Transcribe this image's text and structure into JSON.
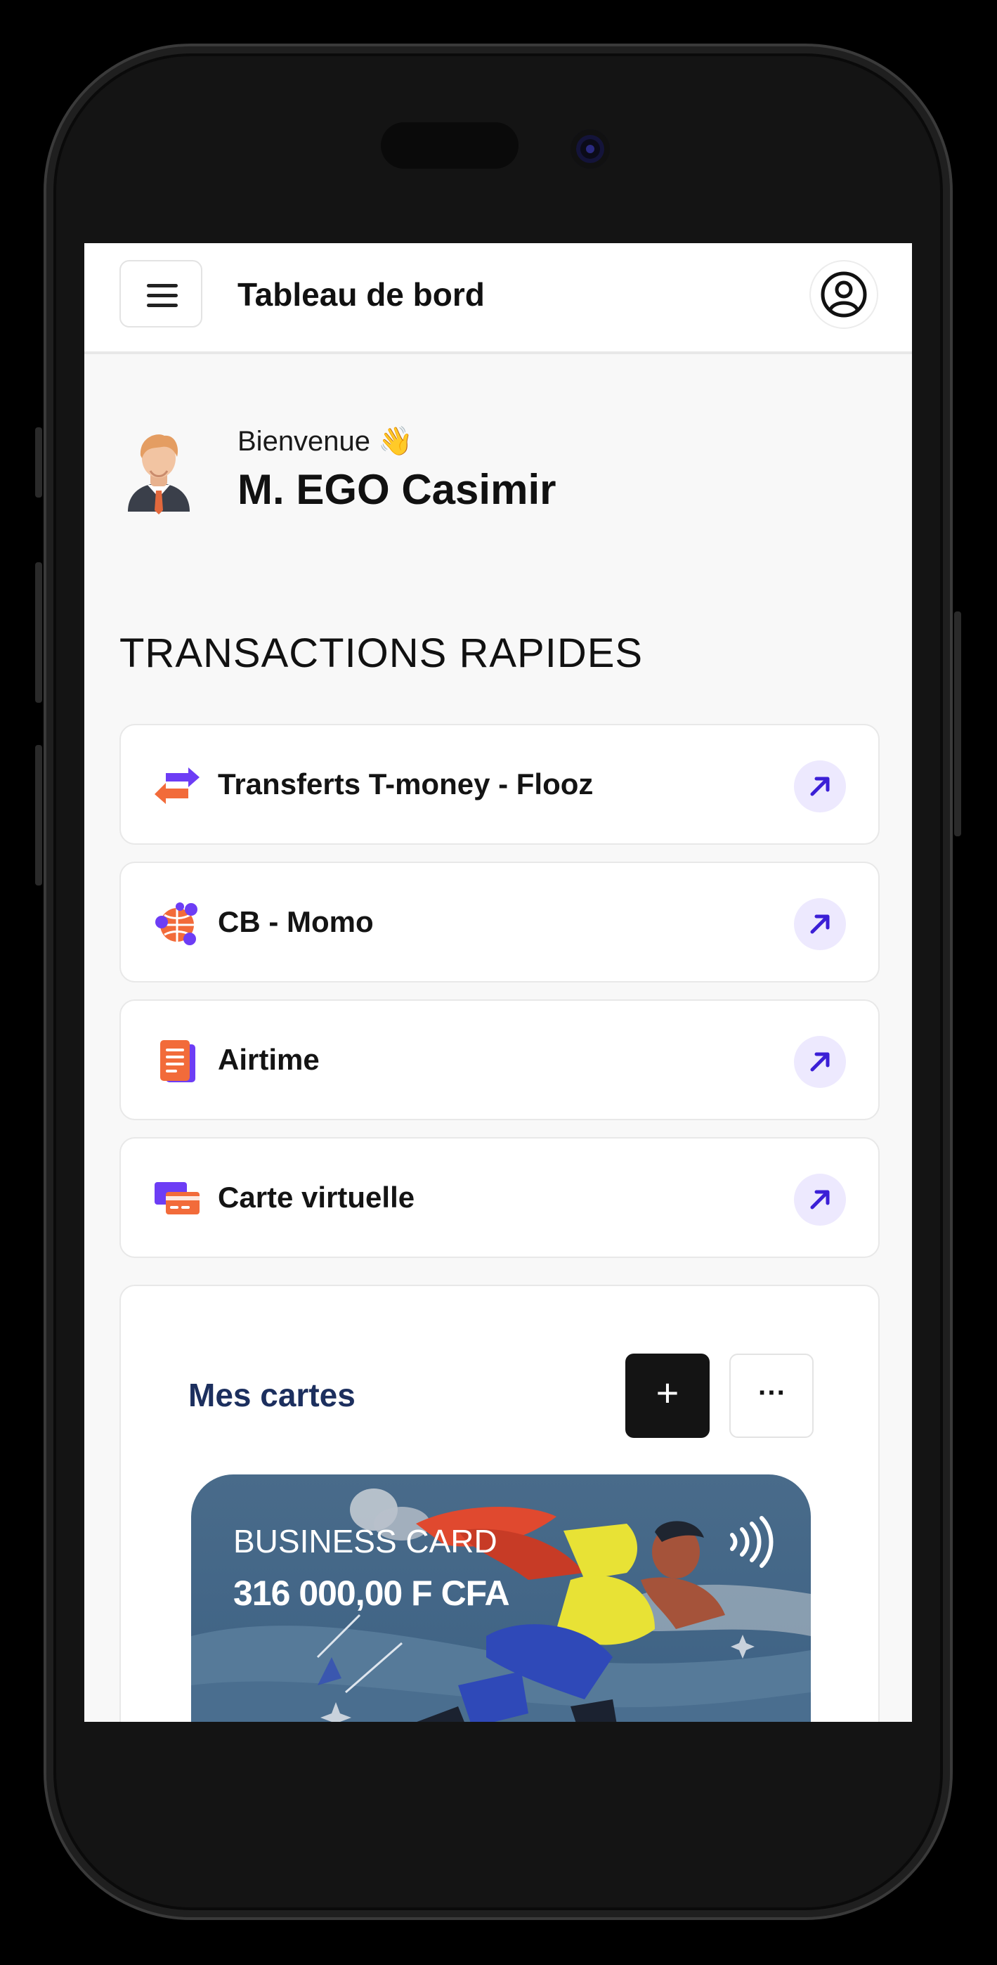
{
  "header": {
    "title": "Tableau de bord",
    "menu_icon": "hamburger-menu-icon",
    "profile_icon": "user-circle-icon"
  },
  "welcome": {
    "greeting": "Bienvenue 👋",
    "name": "M. EGO Casimir",
    "avatar_icon": "businessman-avatar-icon"
  },
  "quick_transactions": {
    "title": "TRANSACTIONS RAPIDES",
    "items": [
      {
        "label": "Transferts T-money - Flooz",
        "icon": "transfer-arrows-icon"
      },
      {
        "label": "CB - Momo",
        "icon": "globe-network-icon"
      },
      {
        "label": "Airtime",
        "icon": "document-icon"
      },
      {
        "label": "Carte virtuelle",
        "icon": "cards-icon"
      }
    ],
    "action_icon": "arrow-up-right-icon"
  },
  "cards": {
    "title": "Mes cartes",
    "add_label": "+",
    "more_label": "···",
    "card": {
      "name": "BUSINESS CARD",
      "balance": "316 000,00 F CFA",
      "contactless_icon": "contactless-icon"
    }
  },
  "colors": {
    "accent_purple": "#5b21b6",
    "arrow_bg": "#ede9fe",
    "title_navy": "#1c2f5e",
    "card_blue": "#436789"
  }
}
